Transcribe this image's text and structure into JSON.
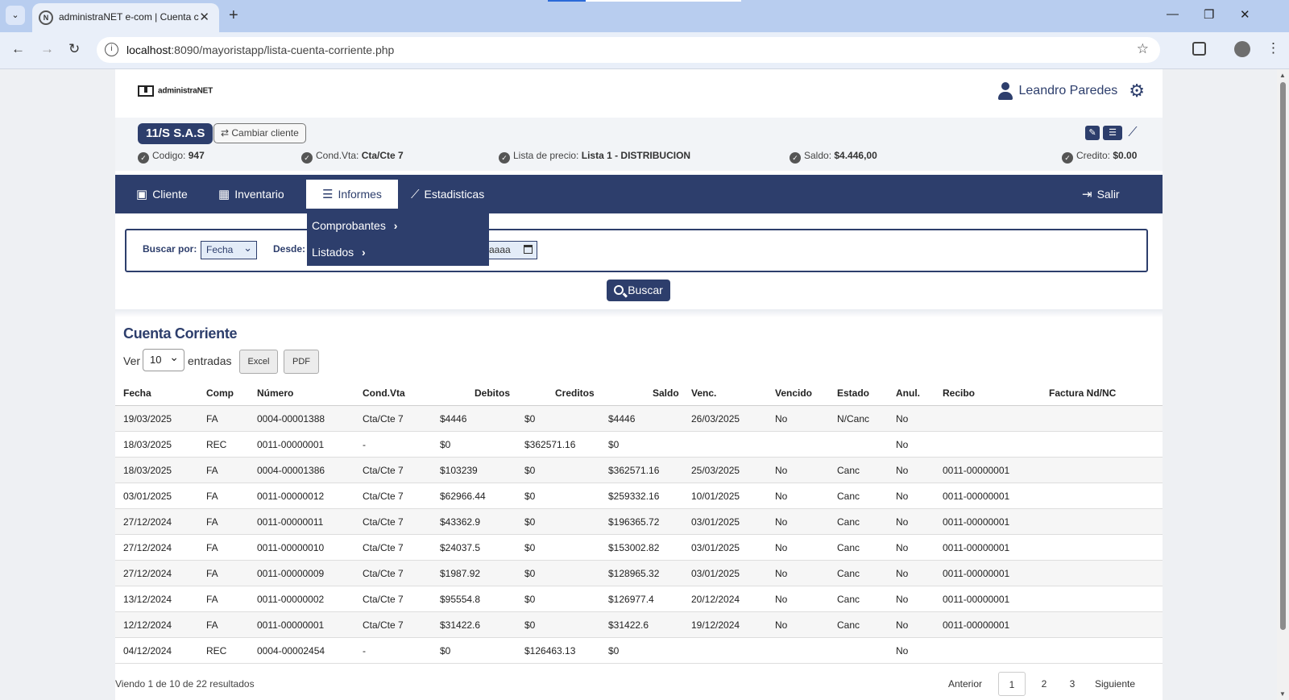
{
  "browser": {
    "tab_title": "administraNET e-com | Cuenta c",
    "url_host": "localhost",
    "url_rest": ":8090/mayoristapp/lista-cuenta-corriente.php"
  },
  "header": {
    "logo_text": "administraNET",
    "user_name": "Leandro Paredes"
  },
  "client": {
    "name": "11/S S.A.S",
    "change_label": "⇄ Cambiar cliente",
    "codigo_label": "Codigo:",
    "codigo_value": "947",
    "condvta_label": "Cond.Vta:",
    "condvta_value": "Cta/Cte 7",
    "lista_label": "Lista de precio:",
    "lista_value": "Lista 1 - DISTRIBUCION",
    "saldo_label": "Saldo:",
    "saldo_value": "$4.446,00",
    "credito_label": "Credito:",
    "credito_value": "$0.00"
  },
  "nav": {
    "cliente": "Cliente",
    "inventario": "Inventario",
    "informes": "Informes",
    "estadisticas": "Estadisticas",
    "salir": "Salir"
  },
  "dropdown": {
    "comprobantes": "Comprobantes",
    "listados": "Listados"
  },
  "search": {
    "buscar_por_label": "Buscar por:",
    "buscar_por_value": "Fecha",
    "desde_label": "Desde:",
    "date_partial": "aaaa",
    "buscar_button": "Buscar"
  },
  "section": {
    "title": "Cuenta Corriente",
    "ver_label": "Ver",
    "entries_value": "10",
    "entradas_label": "entradas",
    "excel_label": "Excel",
    "pdf_label": "PDF"
  },
  "table": {
    "headers": [
      "Fecha",
      "Comp",
      "Número",
      "Cond.Vta",
      "Debitos",
      "Creditos",
      "Saldo",
      "Venc.",
      "Vencido",
      "Estado",
      "Anul.",
      "Recibo",
      "Factura Nd/NC"
    ],
    "rows": [
      [
        "19/03/2025",
        "FA",
        "0004-00001388",
        "Cta/Cte 7",
        "$4446",
        "$0",
        "$4446",
        "26/03/2025",
        "No",
        "N/Canc",
        "No",
        "",
        ""
      ],
      [
        "18/03/2025",
        "REC",
        "0011-00000001",
        "-",
        "$0",
        "$362571.16",
        "$0",
        "",
        "",
        "",
        "No",
        "",
        ""
      ],
      [
        "18/03/2025",
        "FA",
        "0004-00001386",
        "Cta/Cte 7",
        "$103239",
        "$0",
        "$362571.16",
        "25/03/2025",
        "No",
        "Canc",
        "No",
        "0011-00000001",
        ""
      ],
      [
        "03/01/2025",
        "FA",
        "0011-00000012",
        "Cta/Cte 7",
        "$62966.44",
        "$0",
        "$259332.16",
        "10/01/2025",
        "No",
        "Canc",
        "No",
        "0011-00000001",
        ""
      ],
      [
        "27/12/2024",
        "FA",
        "0011-00000011",
        "Cta/Cte 7",
        "$43362.9",
        "$0",
        "$196365.72",
        "03/01/2025",
        "No",
        "Canc",
        "No",
        "0011-00000001",
        ""
      ],
      [
        "27/12/2024",
        "FA",
        "0011-00000010",
        "Cta/Cte 7",
        "$24037.5",
        "$0",
        "$153002.82",
        "03/01/2025",
        "No",
        "Canc",
        "No",
        "0011-00000001",
        ""
      ],
      [
        "27/12/2024",
        "FA",
        "0011-00000009",
        "Cta/Cte 7",
        "$1987.92",
        "$0",
        "$128965.32",
        "03/01/2025",
        "No",
        "Canc",
        "No",
        "0011-00000001",
        ""
      ],
      [
        "13/12/2024",
        "FA",
        "0011-00000002",
        "Cta/Cte 7",
        "$95554.8",
        "$0",
        "$126977.4",
        "20/12/2024",
        "No",
        "Canc",
        "No",
        "0011-00000001",
        ""
      ],
      [
        "12/12/2024",
        "FA",
        "0011-00000001",
        "Cta/Cte 7",
        "$31422.6",
        "$0",
        "$31422.6",
        "19/12/2024",
        "No",
        "Canc",
        "No",
        "0011-00000001",
        ""
      ],
      [
        "04/12/2024",
        "REC",
        "0004-00002454",
        "-",
        "$0",
        "$126463.13",
        "$0",
        "",
        "",
        "",
        "No",
        "",
        ""
      ]
    ]
  },
  "footer": {
    "info": "Viendo 1 de 10 de 22 resultados",
    "anterior": "Anterior",
    "page1": "1",
    "page2": "2",
    "page3": "3",
    "siguiente": "Siguiente"
  }
}
